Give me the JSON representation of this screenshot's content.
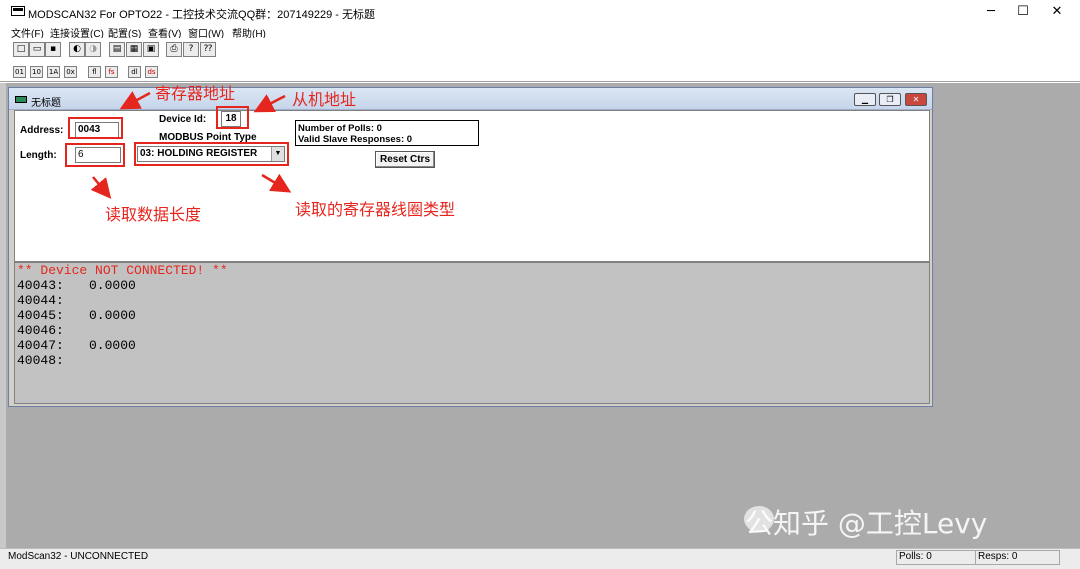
{
  "window": {
    "title": "MODSCAN32 For OPTO22 - 工控技术交流QQ群：207149229 - 无标题",
    "controls": [
      "─",
      "☐",
      "✕"
    ]
  },
  "menubar": [
    "文件(F)",
    "连接设置(C)",
    "配置(S)",
    "查看(V)",
    "窗口(W)",
    "帮助(H)"
  ],
  "toolbar": {
    "icons": [
      "new-file-icon",
      "open-folder-icon",
      "save-icon",
      "connect-icon",
      "disconnect-icon",
      "display-icon-1",
      "display-icon-2",
      "display-icon-3",
      "print-icon",
      "help-icon",
      "context-help-icon"
    ],
    "display_icons": [
      "binary-display-icon",
      "decimal-display-icon",
      "hex-display-icon",
      "integer-display-icon",
      "float-display-icon",
      "float-swapped-display-icon",
      "double-display-icon",
      "double-swapped-display-icon"
    ]
  },
  "child_window": {
    "title": "无标题",
    "address_label": "Address:",
    "address_value": "0043",
    "length_label": "Length:",
    "length_value": "6",
    "device_id_label": "Device Id:",
    "device_id_value": "18",
    "point_type_label": "MODBUS Point Type",
    "point_type_value": "03: HOLDING REGISTER",
    "polls_text": "Number of Polls: 0",
    "responses_text": "Valid Slave Responses: 0",
    "reset_label": "Reset Ctrs",
    "status_message": "** Device NOT CONNECTED! **",
    "registers": [
      {
        "addr": "40043:",
        "value": "0.0000"
      },
      {
        "addr": "40044:",
        "value": ""
      },
      {
        "addr": "40045:",
        "value": "0.0000"
      },
      {
        "addr": "40046:",
        "value": ""
      },
      {
        "addr": "40047:",
        "value": "0.0000"
      },
      {
        "addr": "40048:",
        "value": ""
      }
    ]
  },
  "annotations": {
    "register_address": "寄存器地址",
    "slave_address": "从机地址",
    "read_length": "读取数据长度",
    "register_type": "读取的寄存器线圈类型"
  },
  "statusbar": {
    "text": "ModScan32 - UNCONNECTED",
    "polls": "Polls: 0",
    "resps": "Resps: 0"
  },
  "watermark": "公知乎 @工控Levy",
  "colors": {
    "annotation": "#e5261f",
    "status_red": "#e5261f"
  }
}
